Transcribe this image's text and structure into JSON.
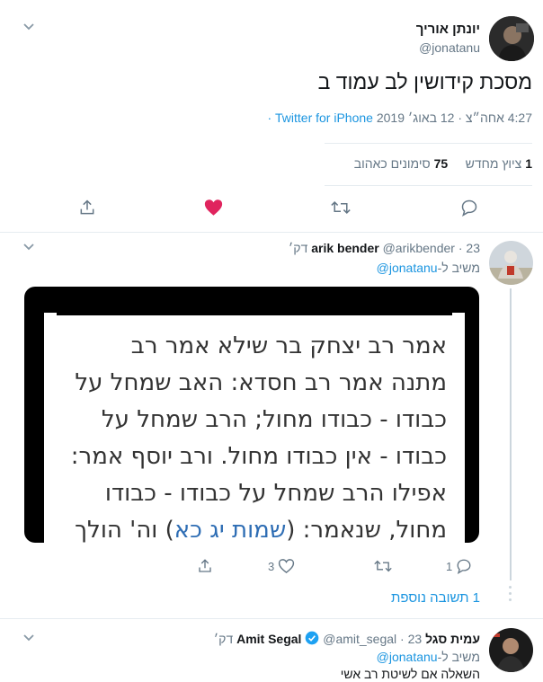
{
  "main_tweet": {
    "display_name": "יונתן אוריך",
    "handle": "@jonatanu",
    "text": "מסכת קידושין לב עמוד ב",
    "time": "4:27 אחה״צ · 12 באוג׳ 2019",
    "source": "Twitter for iPhone",
    "retweets_count": "1",
    "retweets_label": "ציוץ מחדש",
    "likes_count": "75",
    "likes_label": "סימונים כאהוב"
  },
  "reply1": {
    "display_name": "arik bender",
    "handle": "@arikbender",
    "time": "23 דק׳",
    "replying_prefix": "משיב ל-",
    "replying_to": "@jonatanu",
    "image_text_lines": [
      "אמר רב יצחק בר שילא אמר רב",
      "מתנה אמר רב חסדא: האב שמחל על",
      "כבודו - כבודו מחול; הרב שמחל על",
      "כבודו - אין כבודו מחול. ורב יוסף אמר:",
      "אפילו הרב שמחל על כבודו - כבודו"
    ],
    "image_last_line_start": "מחול, שנאמר: (",
    "image_last_line_ref": "שמות יג כא",
    "image_last_line_end": ") וה' הולך",
    "reply_count": "1",
    "like_count": "3",
    "more_replies": "1 תשובה נוספת"
  },
  "reply2": {
    "display_name": "עמית סגל Amit Segal",
    "handle": "@amit_segal",
    "time": "23 דק׳",
    "replying_prefix": "משיב ל-",
    "replying_to": "@jonatanu",
    "text": "השאלה אם לשיטת רב אשי"
  },
  "colors": {
    "accent": "#1b95e0",
    "like": "#e0245e",
    "muted": "#657786",
    "verified": "#1da1f2"
  },
  "icons": [
    "chevron-down-icon",
    "reply-icon",
    "retweet-icon",
    "heart-icon",
    "share-icon",
    "verified-icon"
  ]
}
